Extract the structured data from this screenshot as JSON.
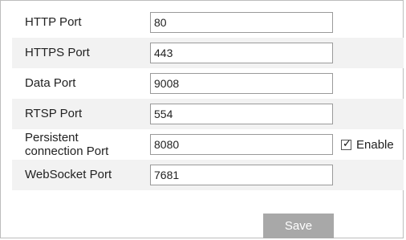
{
  "ports": [
    {
      "label": "HTTP Port",
      "value": "80"
    },
    {
      "label": "HTTPS Port",
      "value": "443"
    },
    {
      "label": "Data Port",
      "value": "9008"
    },
    {
      "label": "RTSP Port",
      "value": "554"
    },
    {
      "label_line1": "Persistent",
      "label_line2": "connection Port",
      "value": "8080",
      "enable_label": "Enable",
      "enable_checked": true
    },
    {
      "label": "WebSocket Port",
      "value": "7681"
    }
  ],
  "actions": {
    "save_label": "Save"
  },
  "colors": {
    "stripe": "#f2f2f2",
    "save_button_bg": "#a8a8a8",
    "input_border": "#9a9a9a"
  }
}
